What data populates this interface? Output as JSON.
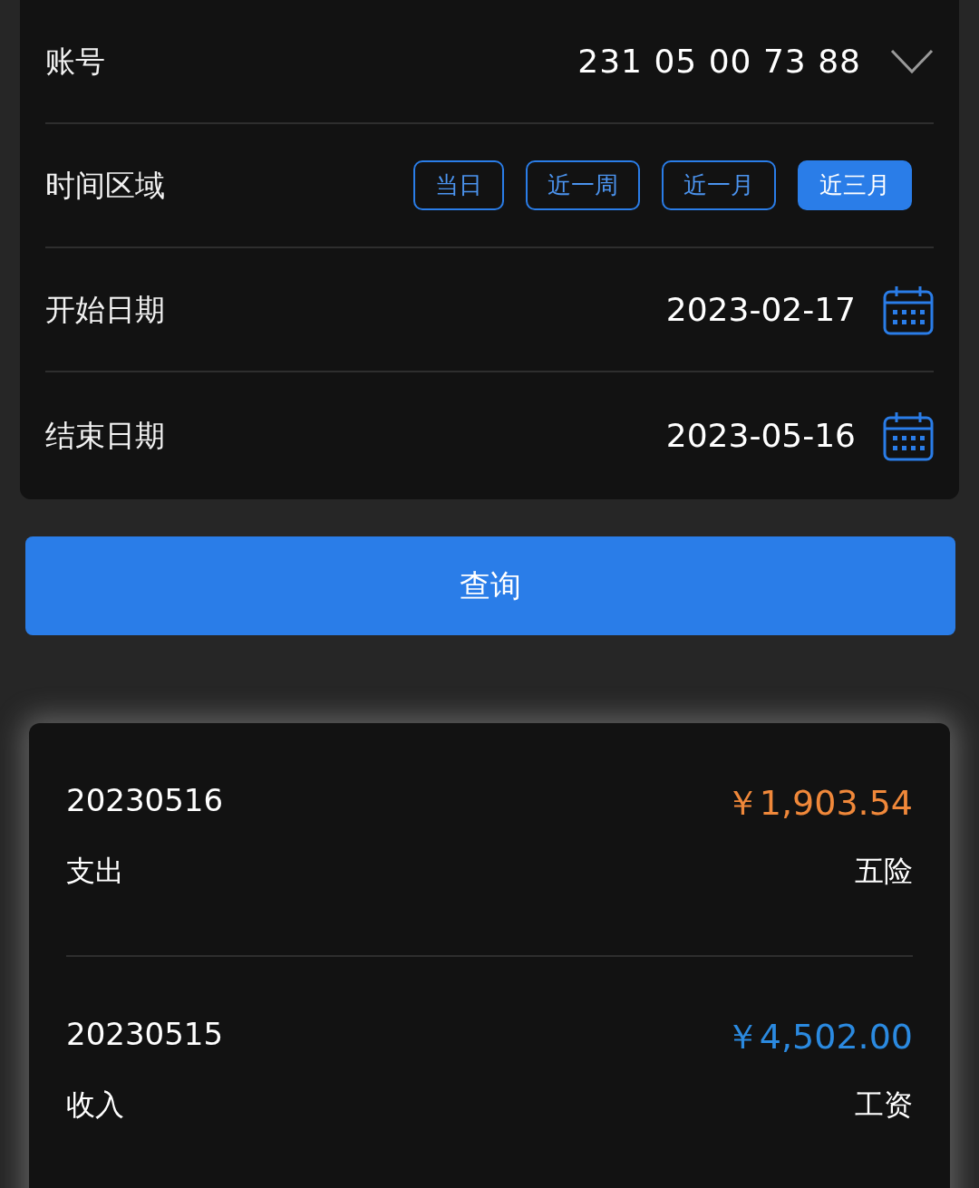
{
  "account": {
    "label": "账号",
    "value": "231 05 00 73 88"
  },
  "period": {
    "label": "时间区域",
    "options": [
      {
        "label": "当日",
        "selected": false
      },
      {
        "label": "近一周",
        "selected": false
      },
      {
        "label": "近一月",
        "selected": false
      },
      {
        "label": "近三月",
        "selected": true
      }
    ]
  },
  "start_date": {
    "label": "开始日期",
    "value": "2023-02-17"
  },
  "end_date": {
    "label": "结束日期",
    "value": "2023-05-16"
  },
  "query_button": "查询",
  "transactions": [
    {
      "date": "20230516",
      "amount": "￥1,903.54",
      "type": "支出",
      "kind": "expense",
      "category": "五险"
    },
    {
      "date": "20230515",
      "amount": "￥4,502.00",
      "type": "收入",
      "kind": "income",
      "category": "工资"
    }
  ]
}
